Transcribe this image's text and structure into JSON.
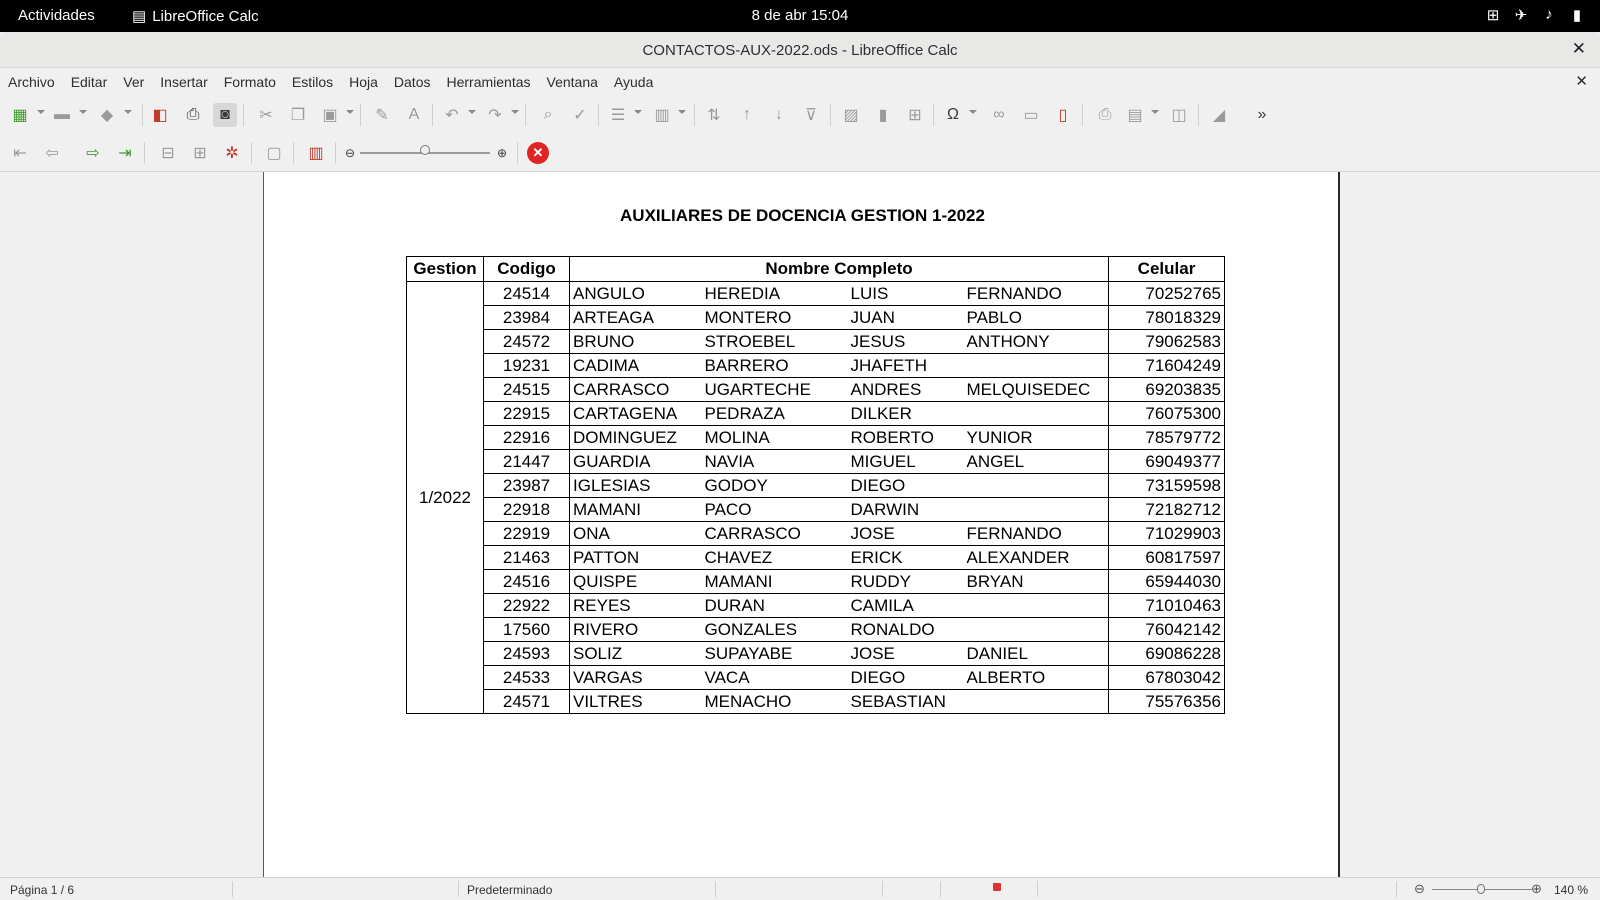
{
  "topbar": {
    "activities": "Actividades",
    "app_name": "LibreOffice Calc",
    "clock": "8 de abr  15:04"
  },
  "window": {
    "title": "CONTACTOS-AUX-2022.ods - LibreOffice Calc"
  },
  "menu": [
    "Archivo",
    "Editar",
    "Ver",
    "Insertar",
    "Formato",
    "Estilos",
    "Hoja",
    "Datos",
    "Herramientas",
    "Ventana",
    "Ayuda"
  ],
  "document": {
    "title": "AUXILIARES DE DOCENCIA GESTION 1-2022",
    "headers": {
      "gestion": "Gestion",
      "codigo": "Codigo",
      "nombre": "Nombre Completo",
      "celular": "Celular"
    },
    "gestion_value": "1/2022",
    "rows": [
      [
        "24514",
        "ANGULO",
        "HEREDIA",
        "LUIS",
        "FERNANDO",
        "70252765"
      ],
      [
        "23984",
        "ARTEAGA",
        "MONTERO",
        "JUAN",
        "PABLO",
        "78018329"
      ],
      [
        "24572",
        "BRUNO",
        "STROEBEL",
        "JESUS",
        "ANTHONY",
        "79062583"
      ],
      [
        "19231",
        "CADIMA",
        "BARRERO",
        "JHAFETH",
        "",
        "71604249"
      ],
      [
        "24515",
        "CARRASCO",
        "UGARTECHE",
        "ANDRES",
        "MELQUISEDEC",
        "69203835"
      ],
      [
        "22915",
        "CARTAGENA",
        "PEDRAZA",
        "DILKER",
        "",
        "76075300"
      ],
      [
        "22916",
        "DOMINGUEZ",
        "MOLINA",
        "ROBERTO",
        "YUNIOR",
        "78579772"
      ],
      [
        "21447",
        "GUARDIA",
        "NAVIA",
        "MIGUEL",
        "ANGEL",
        "69049377"
      ],
      [
        "23987",
        "IGLESIAS",
        "GODOY",
        "DIEGO",
        "",
        "73159598"
      ],
      [
        "22918",
        "MAMANI",
        "PACO",
        "DARWIN",
        "",
        "72182712"
      ],
      [
        "22919",
        "ONA",
        "CARRASCO",
        "JOSE",
        "FERNANDO",
        "71029903"
      ],
      [
        "21463",
        "PATTON",
        "CHAVEZ",
        "ERICK",
        "ALEXANDER",
        "60817597"
      ],
      [
        "24516",
        "QUISPE",
        "MAMANI",
        "RUDDY",
        "BRYAN",
        "65944030"
      ],
      [
        "22922",
        "REYES",
        "DURAN",
        "CAMILA",
        "",
        "71010463"
      ],
      [
        "17560",
        "RIVERO",
        "GONZALES",
        "RONALDO",
        "",
        "76042142"
      ],
      [
        "24593",
        "SOLIZ",
        "SUPAYABE",
        "JOSE",
        "DANIEL",
        "69086228"
      ],
      [
        "24533",
        "VARGAS",
        "VACA",
        "DIEGO",
        "ALBERTO",
        "67803042"
      ],
      [
        "24571",
        "VILTRES",
        "MENACHO",
        "SEBASTIAN",
        "",
        "75576356"
      ]
    ]
  },
  "statusbar": {
    "page": "Página 1 / 6",
    "style": "Predeterminado",
    "zoom": "140 %"
  },
  "toolbar": {
    "more": "»"
  }
}
